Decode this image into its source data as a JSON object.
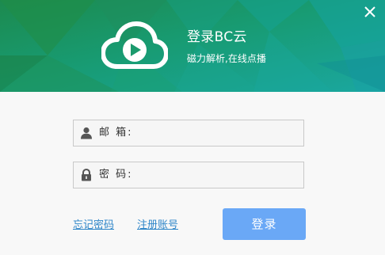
{
  "app": {
    "title": "登录BC云",
    "subtitle": "磁力解析,在线点播"
  },
  "window": {
    "close_symbol": "✕"
  },
  "form": {
    "email_label": "邮 箱:",
    "password_label": "密 码:",
    "email_value": "",
    "password_value": ""
  },
  "links": {
    "forgot_password": "忘记密码",
    "register": "注册账号"
  },
  "buttons": {
    "login": "登录"
  },
  "icons": {
    "logo": "cloud-play-icon",
    "email": "user-icon",
    "password": "lock-icon",
    "close": "close-icon"
  },
  "colors": {
    "accent": "#1aa39a",
    "login_button": "#6aa8f6",
    "link": "#2f86c9"
  }
}
